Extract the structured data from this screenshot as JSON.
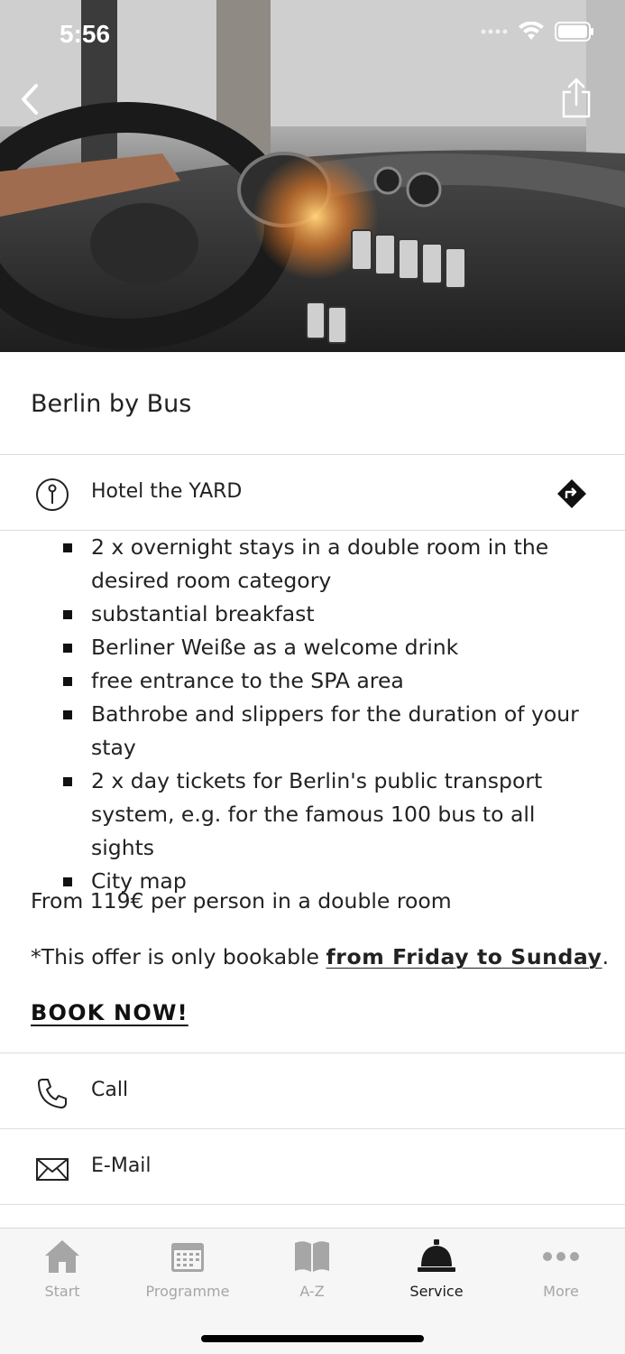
{
  "status_bar": {
    "time": "5:56"
  },
  "header": {
    "back_icon": "chevron-left-icon",
    "share_icon": "share-icon"
  },
  "page": {
    "title": "Berlin by Bus"
  },
  "location": {
    "label": "Hotel the YARD",
    "icon": "pin-icon",
    "action_icon": "directions-icon"
  },
  "features": [
    "2 x overnight stays in a double room in the desired room category",
    "substantial breakfast",
    "Berliner Weiße as a welcome drink",
    "free entrance to the SPA area",
    "Bathrobe and slippers for the duration of your stay",
    "2 x day tickets for Berlin's public transport system, e.g. for the famous 100 bus to all sights",
    "City map"
  ],
  "price_text": "From 119€ per person in a double room",
  "offer": {
    "prefix": "*This offer is only bookable ",
    "highlight": "from Friday to Sunday",
    "suffix": "."
  },
  "book_now": "BOOK NOW!",
  "contacts": [
    {
      "label": "Call",
      "icon": "phone-icon"
    },
    {
      "label": "E-Mail",
      "icon": "mail-icon"
    }
  ],
  "tabs": [
    {
      "label": "Start",
      "icon": "home-icon",
      "active": false
    },
    {
      "label": "Programme",
      "icon": "calendar-icon",
      "active": false
    },
    {
      "label": "A-Z",
      "icon": "book-icon",
      "active": false
    },
    {
      "label": "Service",
      "icon": "service-bell-icon",
      "active": true
    },
    {
      "label": "More",
      "icon": "more-icon",
      "active": false
    }
  ],
  "colors": {
    "active_tab": "#1a1a1a",
    "inactive_tab": "#a6a6a6",
    "divider": "#dddddd"
  }
}
